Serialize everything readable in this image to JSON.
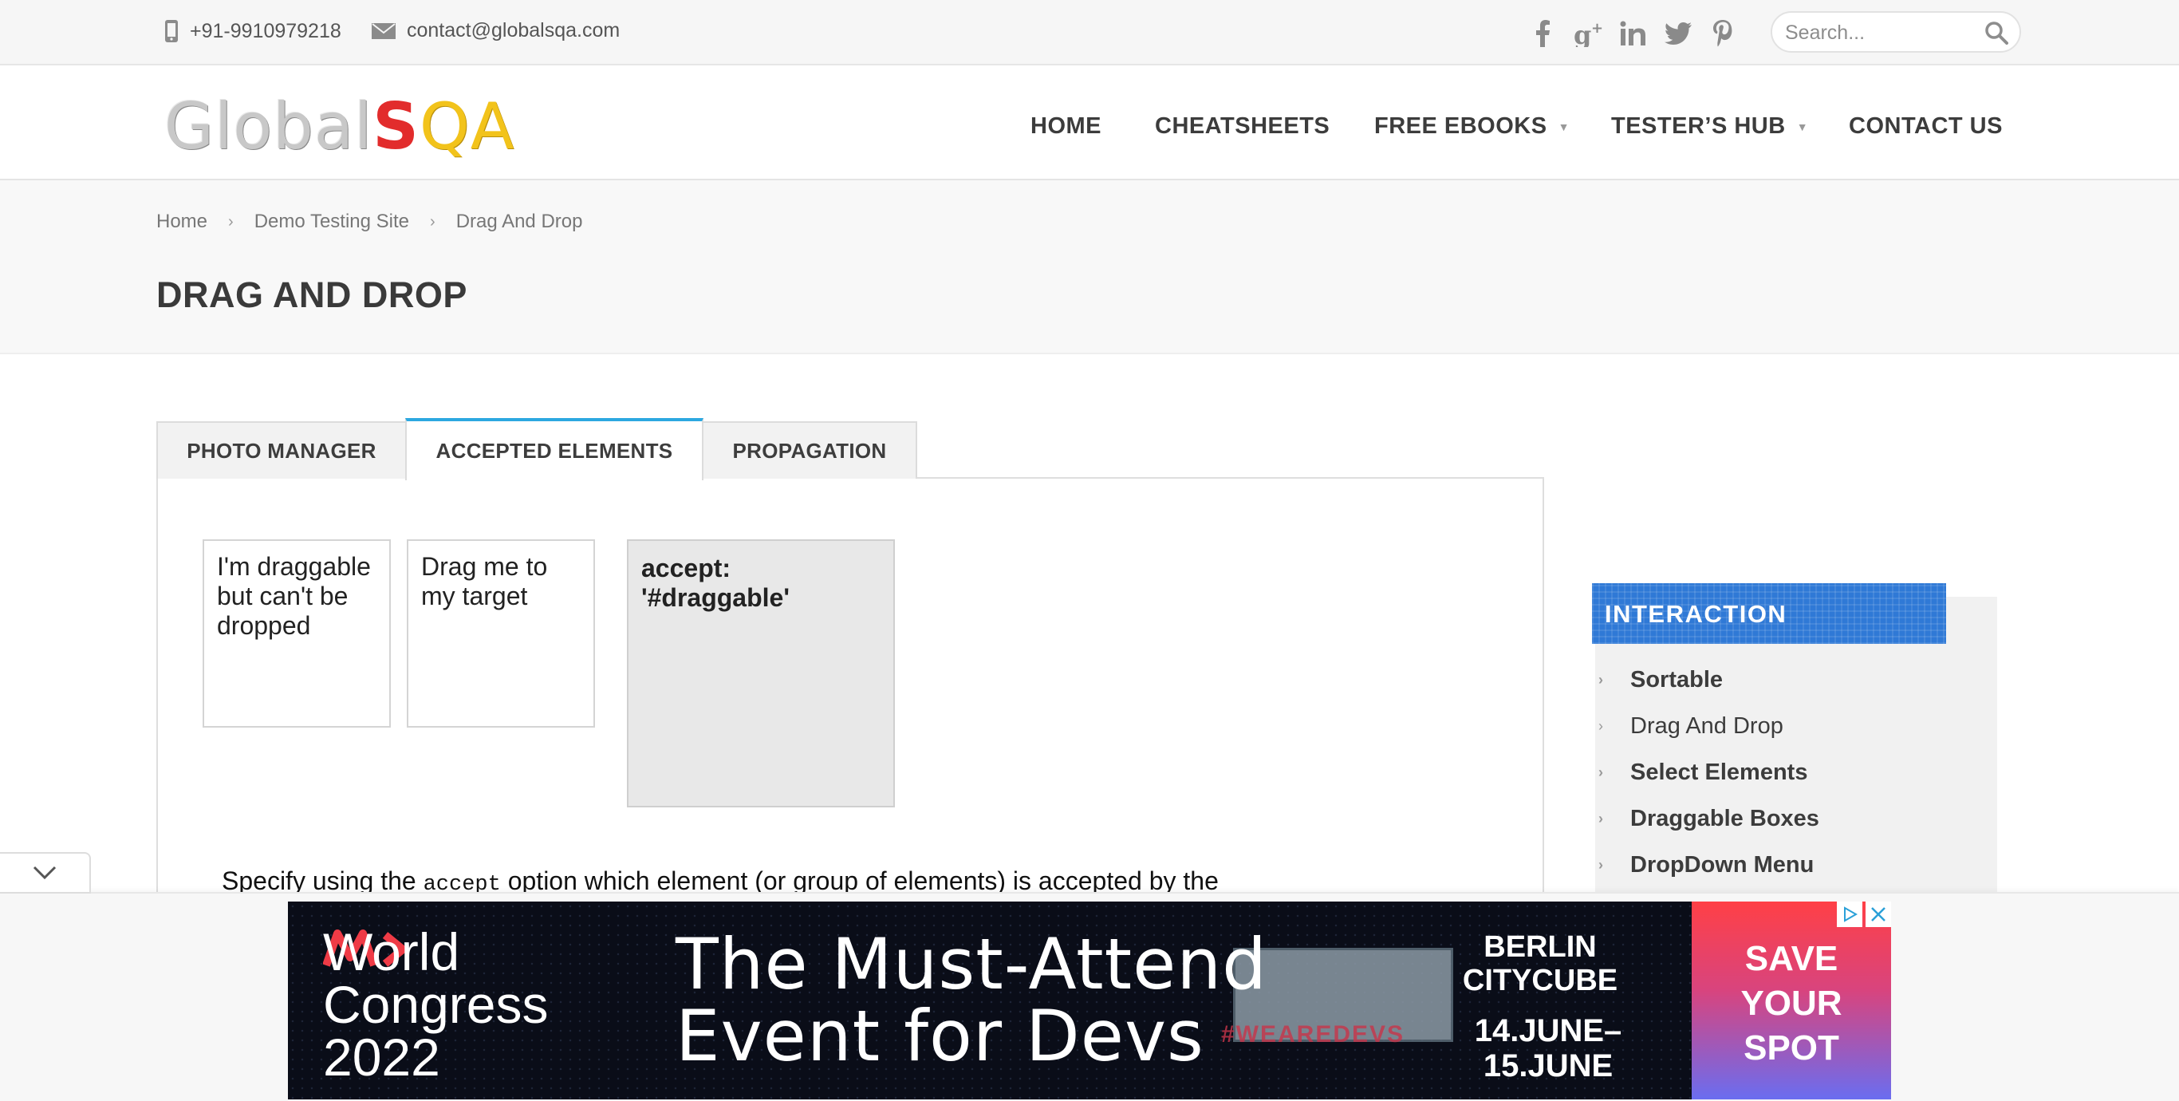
{
  "topbar": {
    "phone": "+91-9910979218",
    "email": "contact@globalsqa.com",
    "social_icons": [
      "facebook-icon",
      "google-plus-icon",
      "linkedin-icon",
      "twitter-icon",
      "pinterest-icon"
    ],
    "search_placeholder": "Search..."
  },
  "header": {
    "logo": {
      "part1": "Global",
      "part2": "S",
      "part3": "QA"
    },
    "nav": [
      {
        "label": "HOME"
      },
      {
        "label": "CHEATSHEETS"
      },
      {
        "label": "FREE EBOOKS",
        "dropdown": true
      },
      {
        "label": "TESTER’S HUB",
        "dropdown": true
      },
      {
        "label": "CONTACT US"
      }
    ]
  },
  "breadcrumb": [
    "Home",
    "Demo Testing Site",
    "Drag And Drop"
  ],
  "page_title": "DRAG AND DROP",
  "tabs": [
    {
      "label": "PHOTO MANAGER",
      "active": false
    },
    {
      "label": "ACCEPTED ELEMENTS",
      "active": true
    },
    {
      "label": "PROPAGATION",
      "active": false
    }
  ],
  "demo": {
    "non_valid_box": "I'm draggable but can't be dropped",
    "draggable_box": "Drag me to my target",
    "droppable_box": "accept: '#draggable'",
    "description": {
      "before": "Specify using the ",
      "code": "accept",
      "after": " option which element (or group of elements) is accepted by the"
    }
  },
  "sidebar": {
    "title": "INTERACTION",
    "items": [
      {
        "label": "Sortable",
        "bold": true
      },
      {
        "label": "Drag And Drop",
        "bold": false
      },
      {
        "label": "Select Elements",
        "bold": true
      },
      {
        "label": "Draggable Boxes",
        "bold": true
      },
      {
        "label": "DropDown Menu",
        "bold": true
      }
    ]
  },
  "ad": {
    "brand": "World\nCongress\n2022",
    "headline": "The Must-Attend\nEvent for Devs",
    "location": "BERLIN\nCITYCUBE",
    "dates": "14.JUNE–\n15.JUNE",
    "cta": "SAVE\nYOUR\nSPOT",
    "hashtag": "#WEAREDEVS"
  },
  "colors": {
    "accent": "#2da8e0",
    "widget_header": "#2f79d6",
    "logo_red": "#e22c2c",
    "logo_yellow": "#f2c31b"
  }
}
